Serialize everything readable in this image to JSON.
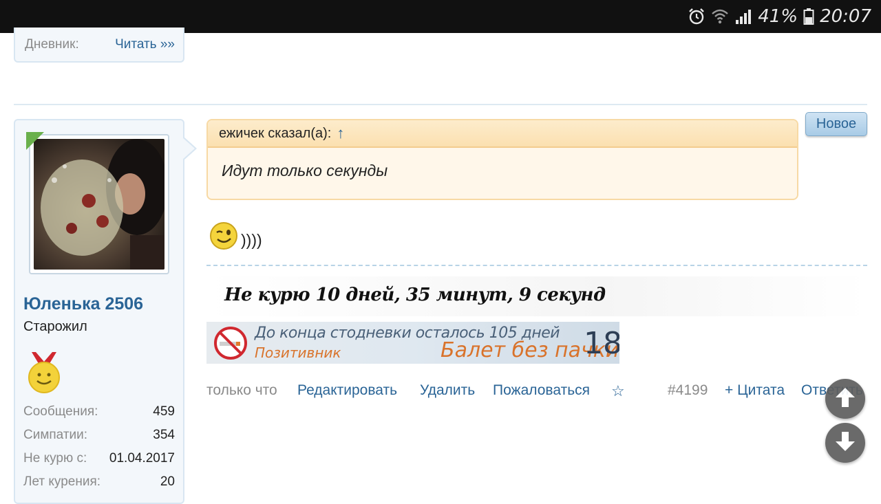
{
  "status_bar": {
    "battery_percent": "41%",
    "time": "20:07",
    "icons": [
      "alarm-icon",
      "wifi-icon",
      "signal-icon",
      "battery-icon"
    ]
  },
  "prev_post": {
    "diary_label": "Дневник:",
    "diary_link": "Читать »»"
  },
  "user": {
    "name": "Юленька 2506",
    "title": "Старожил",
    "stats": [
      {
        "label": "Сообщения:",
        "value": "459"
      },
      {
        "label": "Симпатии:",
        "value": "354"
      },
      {
        "label": "Не курю с:",
        "value": "01.04.2017"
      },
      {
        "label": "Лет курения:",
        "value": "20"
      }
    ]
  },
  "post": {
    "new_badge": "Новое",
    "quote": {
      "author": "ежичек сказал(а):",
      "arrow": "↑",
      "text": "Идут только секунды"
    },
    "message_text": "))))",
    "signature": {
      "counter_text": "Не курю 10 дней, 35 минут, 9 секунд",
      "banner_line1": "До конца стодневки осталось 105 дней",
      "banner_line2": "Позитивник",
      "banner_line3": "Балет без пачки",
      "banner_number": "18"
    },
    "actions": {
      "time": "только что",
      "edit": "Редактировать",
      "delete": "Удалить",
      "report": "Пожаловаться",
      "star": "☆",
      "post_number": "#4199",
      "quote": "+ Цитата",
      "reply": "Ответить"
    }
  },
  "colors": {
    "link": "#2a6496",
    "sidebar_bg": "#f3f7fb",
    "quote_bg": "#fff7ea",
    "quote_border": "#f7d9a4"
  }
}
